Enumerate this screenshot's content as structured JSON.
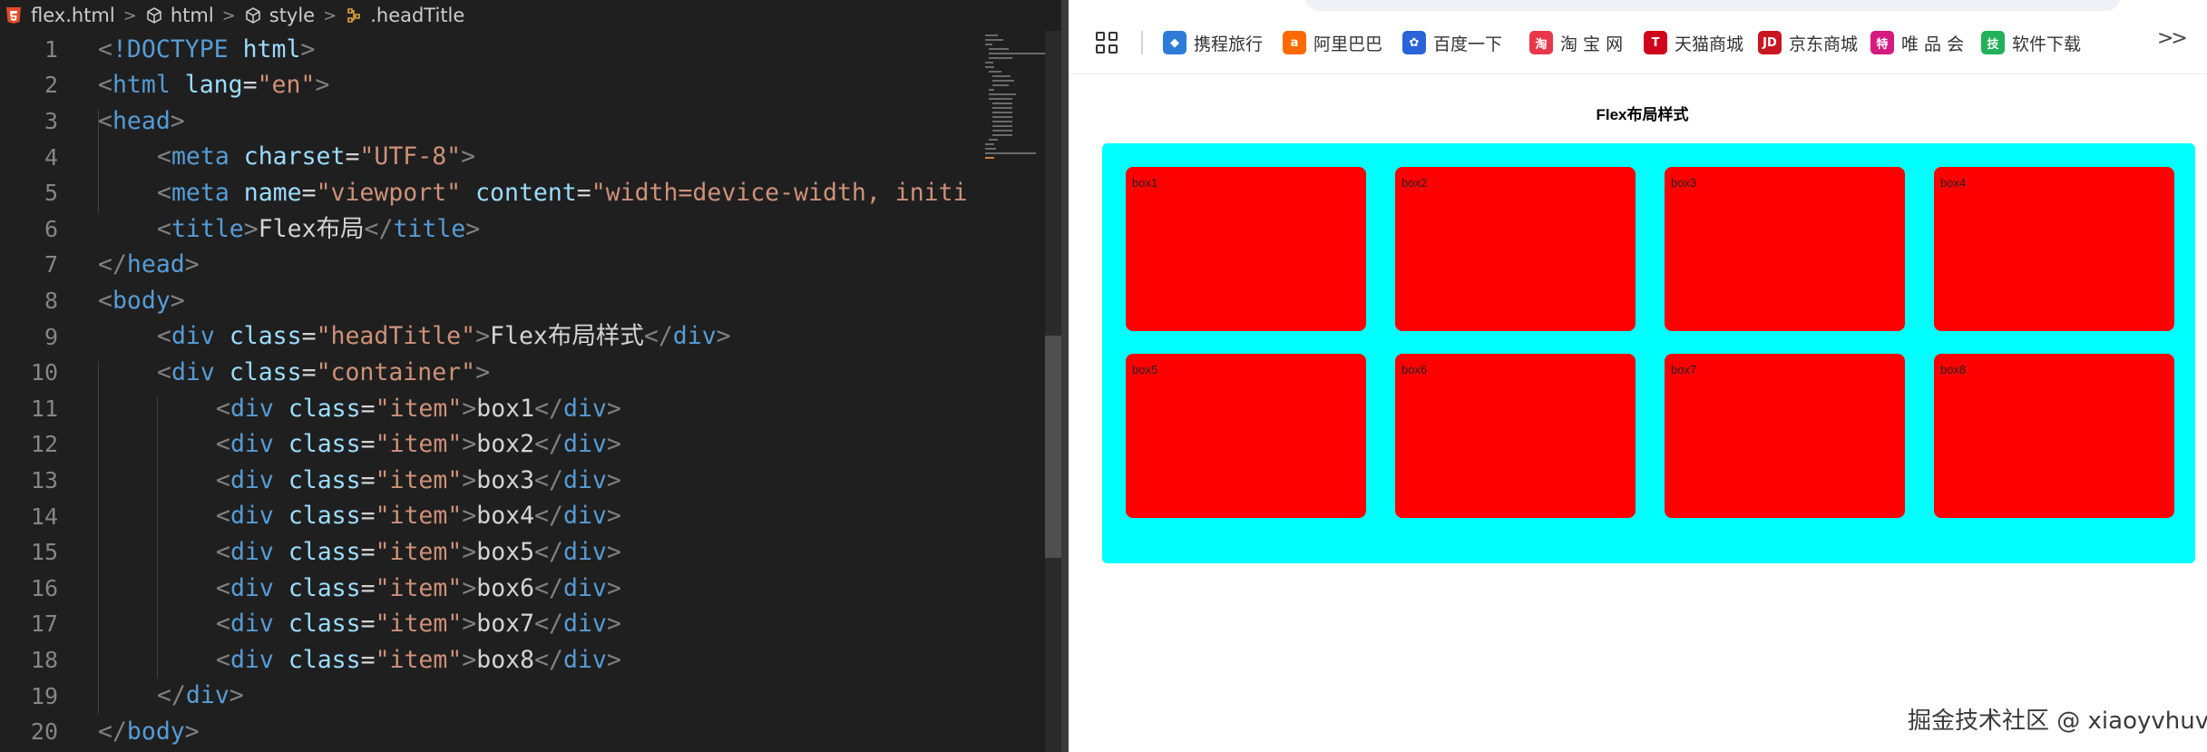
{
  "editor": {
    "breadcrumb": [
      "flex.html",
      "html",
      "style",
      ".headTitle"
    ],
    "lines": [
      {
        "n": "1",
        "indent": 0,
        "tokens": [
          [
            "t-punct",
            "<"
          ],
          [
            "t-tag",
            "!DOCTYPE"
          ],
          [
            "t-text",
            " "
          ],
          [
            "t-attr",
            "html"
          ],
          [
            "t-punct",
            ">"
          ]
        ]
      },
      {
        "n": "2",
        "indent": 0,
        "tokens": [
          [
            "t-punct",
            "<"
          ],
          [
            "t-tag",
            "html"
          ],
          [
            "t-text",
            " "
          ],
          [
            "t-attr",
            "lang"
          ],
          [
            "t-text",
            "="
          ],
          [
            "t-str",
            "\"en\""
          ],
          [
            "t-punct",
            ">"
          ]
        ]
      },
      {
        "n": "3",
        "indent": 0,
        "tokens": [
          [
            "t-punct",
            "<"
          ],
          [
            "t-tag",
            "head"
          ],
          [
            "t-punct",
            ">"
          ]
        ]
      },
      {
        "n": "4",
        "indent": 1,
        "tokens": [
          [
            "t-punct",
            "<"
          ],
          [
            "t-tag",
            "meta"
          ],
          [
            "t-text",
            " "
          ],
          [
            "t-attr",
            "charset"
          ],
          [
            "t-text",
            "="
          ],
          [
            "t-str",
            "\"UTF-8\""
          ],
          [
            "t-punct",
            ">"
          ]
        ]
      },
      {
        "n": "5",
        "indent": 1,
        "tokens": [
          [
            "t-punct",
            "<"
          ],
          [
            "t-tag",
            "meta"
          ],
          [
            "t-text",
            " "
          ],
          [
            "t-attr",
            "name"
          ],
          [
            "t-text",
            "="
          ],
          [
            "t-str",
            "\"viewport\""
          ],
          [
            "t-text",
            " "
          ],
          [
            "t-attr",
            "content"
          ],
          [
            "t-text",
            "="
          ],
          [
            "t-str",
            "\"width=device-width, initi"
          ]
        ]
      },
      {
        "n": "6",
        "indent": 1,
        "tokens": [
          [
            "t-punct",
            "<"
          ],
          [
            "t-tag",
            "title"
          ],
          [
            "t-punct",
            ">"
          ],
          [
            "t-text",
            "Flex布局"
          ],
          [
            "t-punct",
            "</"
          ],
          [
            "t-tag",
            "title"
          ],
          [
            "t-punct",
            ">"
          ]
        ]
      },
      {
        "n": "7",
        "indent": 0,
        "tokens": [
          [
            "t-punct",
            "</"
          ],
          [
            "t-tag",
            "head"
          ],
          [
            "t-punct",
            ">"
          ]
        ]
      },
      {
        "n": "8",
        "indent": 0,
        "tokens": [
          [
            "t-punct",
            "<"
          ],
          [
            "t-tag",
            "body"
          ],
          [
            "t-punct",
            ">"
          ]
        ]
      },
      {
        "n": "9",
        "indent": 1,
        "tokens": [
          [
            "t-punct",
            "<"
          ],
          [
            "t-tag",
            "div"
          ],
          [
            "t-text",
            " "
          ],
          [
            "t-attr",
            "class"
          ],
          [
            "t-text",
            "="
          ],
          [
            "t-str",
            "\"headTitle\""
          ],
          [
            "t-punct",
            ">"
          ],
          [
            "t-text",
            "Flex布局样式"
          ],
          [
            "t-punct",
            "</"
          ],
          [
            "t-tag",
            "div"
          ],
          [
            "t-punct",
            ">"
          ]
        ]
      },
      {
        "n": "10",
        "indent": 1,
        "tokens": [
          [
            "t-punct",
            "<"
          ],
          [
            "t-tag",
            "div"
          ],
          [
            "t-text",
            " "
          ],
          [
            "t-attr",
            "class"
          ],
          [
            "t-text",
            "="
          ],
          [
            "t-str",
            "\"container\""
          ],
          [
            "t-punct",
            ">"
          ]
        ]
      },
      {
        "n": "11",
        "indent": 2,
        "tokens": [
          [
            "t-punct",
            "<"
          ],
          [
            "t-tag",
            "div"
          ],
          [
            "t-text",
            " "
          ],
          [
            "t-attr",
            "class"
          ],
          [
            "t-text",
            "="
          ],
          [
            "t-str",
            "\"item\""
          ],
          [
            "t-punct",
            ">"
          ],
          [
            "t-text",
            "box1"
          ],
          [
            "t-punct",
            "</"
          ],
          [
            "t-tag",
            "div"
          ],
          [
            "t-punct",
            ">"
          ]
        ]
      },
      {
        "n": "12",
        "indent": 2,
        "tokens": [
          [
            "t-punct",
            "<"
          ],
          [
            "t-tag",
            "div"
          ],
          [
            "t-text",
            " "
          ],
          [
            "t-attr",
            "class"
          ],
          [
            "t-text",
            "="
          ],
          [
            "t-str",
            "\"item\""
          ],
          [
            "t-punct",
            ">"
          ],
          [
            "t-text",
            "box2"
          ],
          [
            "t-punct",
            "</"
          ],
          [
            "t-tag",
            "div"
          ],
          [
            "t-punct",
            ">"
          ]
        ]
      },
      {
        "n": "13",
        "indent": 2,
        "tokens": [
          [
            "t-punct",
            "<"
          ],
          [
            "t-tag",
            "div"
          ],
          [
            "t-text",
            " "
          ],
          [
            "t-attr",
            "class"
          ],
          [
            "t-text",
            "="
          ],
          [
            "t-str",
            "\"item\""
          ],
          [
            "t-punct",
            ">"
          ],
          [
            "t-text",
            "box3"
          ],
          [
            "t-punct",
            "</"
          ],
          [
            "t-tag",
            "div"
          ],
          [
            "t-punct",
            ">"
          ]
        ]
      },
      {
        "n": "14",
        "indent": 2,
        "tokens": [
          [
            "t-punct",
            "<"
          ],
          [
            "t-tag",
            "div"
          ],
          [
            "t-text",
            " "
          ],
          [
            "t-attr",
            "class"
          ],
          [
            "t-text",
            "="
          ],
          [
            "t-str",
            "\"item\""
          ],
          [
            "t-punct",
            ">"
          ],
          [
            "t-text",
            "box4"
          ],
          [
            "t-punct",
            "</"
          ],
          [
            "t-tag",
            "div"
          ],
          [
            "t-punct",
            ">"
          ]
        ]
      },
      {
        "n": "15",
        "indent": 2,
        "tokens": [
          [
            "t-punct",
            "<"
          ],
          [
            "t-tag",
            "div"
          ],
          [
            "t-text",
            " "
          ],
          [
            "t-attr",
            "class"
          ],
          [
            "t-text",
            "="
          ],
          [
            "t-str",
            "\"item\""
          ],
          [
            "t-punct",
            ">"
          ],
          [
            "t-text",
            "box5"
          ],
          [
            "t-punct",
            "</"
          ],
          [
            "t-tag",
            "div"
          ],
          [
            "t-punct",
            ">"
          ]
        ]
      },
      {
        "n": "16",
        "indent": 2,
        "tokens": [
          [
            "t-punct",
            "<"
          ],
          [
            "t-tag",
            "div"
          ],
          [
            "t-text",
            " "
          ],
          [
            "t-attr",
            "class"
          ],
          [
            "t-text",
            "="
          ],
          [
            "t-str",
            "\"item\""
          ],
          [
            "t-punct",
            ">"
          ],
          [
            "t-text",
            "box6"
          ],
          [
            "t-punct",
            "</"
          ],
          [
            "t-tag",
            "div"
          ],
          [
            "t-punct",
            ">"
          ]
        ]
      },
      {
        "n": "17",
        "indent": 2,
        "tokens": [
          [
            "t-punct",
            "<"
          ],
          [
            "t-tag",
            "div"
          ],
          [
            "t-text",
            " "
          ],
          [
            "t-attr",
            "class"
          ],
          [
            "t-text",
            "="
          ],
          [
            "t-str",
            "\"item\""
          ],
          [
            "t-punct",
            ">"
          ],
          [
            "t-text",
            "box7"
          ],
          [
            "t-punct",
            "</"
          ],
          [
            "t-tag",
            "div"
          ],
          [
            "t-punct",
            ">"
          ]
        ]
      },
      {
        "n": "18",
        "indent": 2,
        "tokens": [
          [
            "t-punct",
            "<"
          ],
          [
            "t-tag",
            "div"
          ],
          [
            "t-text",
            " "
          ],
          [
            "t-attr",
            "class"
          ],
          [
            "t-text",
            "="
          ],
          [
            "t-str",
            "\"item\""
          ],
          [
            "t-punct",
            ">"
          ],
          [
            "t-text",
            "box8"
          ],
          [
            "t-punct",
            "</"
          ],
          [
            "t-tag",
            "div"
          ],
          [
            "t-punct",
            ">"
          ]
        ]
      },
      {
        "n": "19",
        "indent": 1,
        "tokens": [
          [
            "t-punct",
            "</"
          ],
          [
            "t-tag",
            "div"
          ],
          [
            "t-punct",
            ">"
          ]
        ]
      },
      {
        "n": "20",
        "indent": 0,
        "tokens": [
          [
            "t-punct",
            "</"
          ],
          [
            "t-tag",
            "body"
          ],
          [
            "t-punct",
            ">"
          ]
        ]
      }
    ]
  },
  "browser": {
    "bookmarks": [
      {
        "label": "携程旅行",
        "icon": "ctrip-dolphin-icon",
        "color": "#2f7bd8",
        "glyph": "◆"
      },
      {
        "label": "阿里巴巴",
        "icon": "alibaba-icon",
        "color": "#ff6a00",
        "glyph": "a"
      },
      {
        "label": "百度一下",
        "icon": "baidu-paw-icon",
        "color": "#2b63d9",
        "glyph": "✿"
      },
      {
        "label": "淘 宝 网",
        "icon": "taobao-icon",
        "color": "#e8374b",
        "glyph": "淘"
      },
      {
        "label": "天猫商城",
        "icon": "tmall-icon",
        "color": "#d0021b",
        "glyph": "T"
      },
      {
        "label": "京东商城",
        "icon": "jd-icon",
        "color": "#c91623",
        "glyph": "JD"
      },
      {
        "label": "唯 品 会",
        "icon": "vip-icon",
        "color": "#d61a7f",
        "glyph": "特"
      },
      {
        "label": "软件下载",
        "icon": "software-download-icon",
        "color": "#20b15a",
        "glyph": "技"
      }
    ],
    "more_label": ">>",
    "head_title": "Flex布局样式",
    "container_color": "#00ffff",
    "item_color": "#ff0000",
    "items": [
      "box1",
      "box2",
      "box3",
      "box4",
      "box5",
      "box6",
      "box7",
      "box8"
    ]
  },
  "watermark": "掘金技术社区 @ xiaoyvhuv"
}
